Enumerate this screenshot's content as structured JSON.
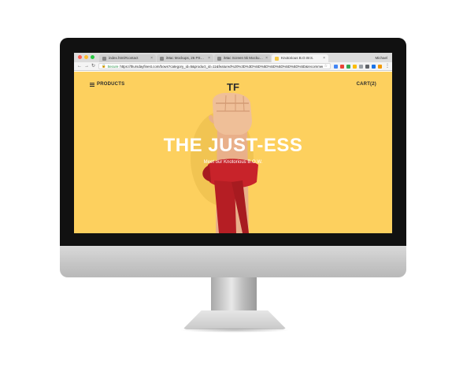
{
  "browser": {
    "tabs": [
      {
        "label": "index.html#contact",
        "active": false
      },
      {
        "label": "iMac Mockups, 26 PSD Files",
        "active": false
      },
      {
        "label": "iMac Screen 5k Mockup V3",
        "active": false
      },
      {
        "label": "Knotorious B.O.W.S.",
        "active": true
      }
    ],
    "profile_name": "Michael",
    "secure_label": "Secure",
    "url": "https://thursdayfinest.com/bows?category_id=5&product_id=11&featured%20%3D%3D%5D%5D%5D%5D%5D%5D%5D&recommended",
    "icons": {
      "back": "arrow-left-icon",
      "forward": "arrow-right-icon",
      "reload": "reload-icon",
      "lock": "lock-icon",
      "bookmark": "star-icon",
      "menu": "kebab-menu-icon"
    },
    "extension_colors": [
      "#4285f4",
      "#ea4335",
      "#34a853",
      "#fbbc05",
      "#9aa0a6",
      "#5f6368",
      "#1a73e8",
      "#f29900"
    ]
  },
  "site": {
    "logo_text": "TF",
    "menu_label": "PRODUCTS",
    "cart_label": "CART(2)",
    "hero_title": "THE JUST-ESS",
    "hero_subtitle": "Meet our Knotorious B.O.W.",
    "background_color": "#fdd05e",
    "accent_color": "#c8232a"
  }
}
